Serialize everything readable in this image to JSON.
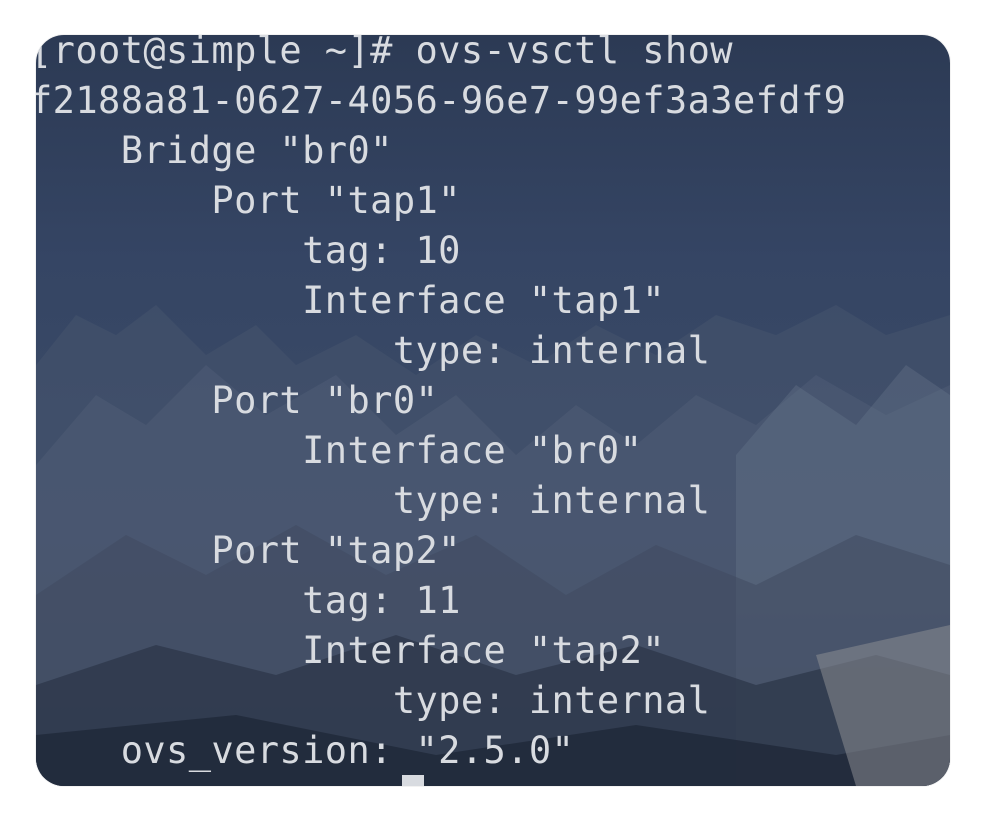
{
  "terminal": {
    "lines": [
      "[root@simple ~]# ovs-vsctl show",
      "f2188a81-0627-4056-96e7-99ef3a3efdf9",
      "    Bridge \"br0\"",
      "        Port \"tap1\"",
      "            tag: 10",
      "            Interface \"tap1\"",
      "                type: internal",
      "        Port \"br0\"",
      "            Interface \"br0\"",
      "                type: internal",
      "        Port \"tap2\"",
      "            tag: 11",
      "            Interface \"tap2\"",
      "                type: internal",
      "    ovs_version: \"2.5.0\""
    ]
  },
  "colors": {
    "text": "#d8dbe0",
    "background_top": "#2c3a54",
    "background_bottom": "#2f3a4e"
  }
}
